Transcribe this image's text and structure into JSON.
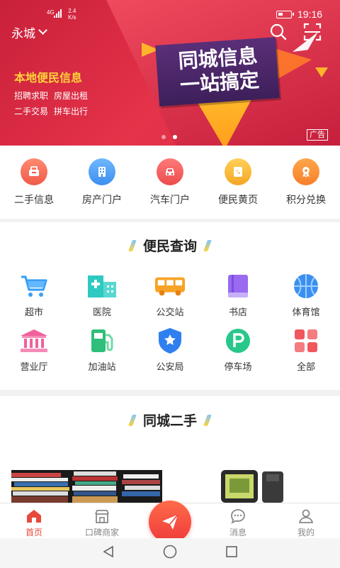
{
  "status": {
    "signal_label": "4G",
    "speed_value": "2.4",
    "speed_unit": "K/s",
    "time": "19:16"
  },
  "header": {
    "city": "永城",
    "search_icon": "search-icon",
    "scan_icon": "scan-icon"
  },
  "banner": {
    "headline_line1": "同城信息",
    "headline_line2": "一站搞定",
    "local_title": "本地便民信息",
    "tags": [
      "招聘求职",
      "房屋出租",
      "二手交易",
      "拼车出行"
    ],
    "ad_label": "广告",
    "active_slide": 2,
    "slide_count": 2
  },
  "quick_entries": [
    {
      "label": "二手信息",
      "icon": "basket-icon",
      "color": "#f26a5a"
    },
    {
      "label": "房产门户",
      "icon": "building-icon",
      "color": "#4a9ff5"
    },
    {
      "label": "汽车门户",
      "icon": "car-icon",
      "color": "#f05a5a"
    },
    {
      "label": "便民黄页",
      "icon": "phone-book-icon",
      "color": "#f7b52b"
    },
    {
      "label": "积分兑换",
      "icon": "medal-icon",
      "color": "#f8902d"
    }
  ],
  "services": {
    "title": "便民查询",
    "items": [
      {
        "label": "超市",
        "icon": "cart-icon"
      },
      {
        "label": "医院",
        "icon": "hospital-icon"
      },
      {
        "label": "公交站",
        "icon": "bus-icon"
      },
      {
        "label": "书店",
        "icon": "book-icon"
      },
      {
        "label": "体育馆",
        "icon": "basketball-icon"
      },
      {
        "label": "营业厅",
        "icon": "bank-icon"
      },
      {
        "label": "加油站",
        "icon": "gas-pump-icon"
      },
      {
        "label": "公安局",
        "icon": "police-shield-icon"
      },
      {
        "label": "停车场",
        "icon": "parking-icon"
      },
      {
        "label": "全部",
        "icon": "grid-icon"
      }
    ]
  },
  "secondhand": {
    "title": "同城二手"
  },
  "tabs": [
    {
      "label": "首页",
      "icon": "home-icon",
      "active": true
    },
    {
      "label": "口碑商家",
      "icon": "shop-icon",
      "active": false
    },
    {
      "label": "消息",
      "icon": "message-icon",
      "active": false
    },
    {
      "label": "我的",
      "icon": "user-icon",
      "active": false
    }
  ],
  "colors": {
    "accent": "#e8493a",
    "banner_red": "#d62b45",
    "headline_purple": "#4a2668",
    "headline_yellow": "#ffd43a"
  }
}
